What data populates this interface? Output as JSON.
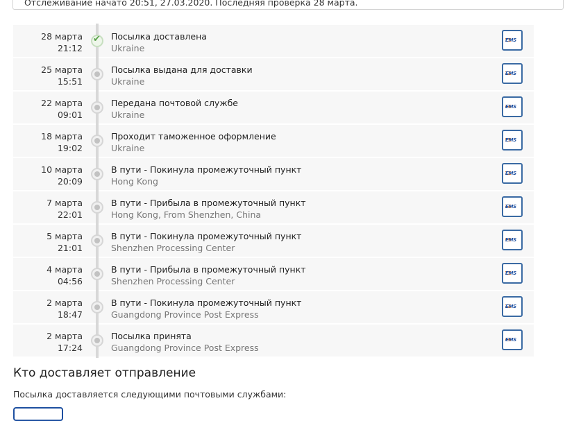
{
  "notice": {
    "text": "Отслеживание начато 20:51, 27.03.2020. Последняя проверка 28 марта."
  },
  "events": [
    {
      "date": "28 марта",
      "time": "21:12",
      "status": "Посылка доставлена",
      "location": "Ukraine",
      "done": true
    },
    {
      "date": "25 марта",
      "time": "15:51",
      "status": "Посылка выдана для доставки",
      "location": "Ukraine",
      "done": false
    },
    {
      "date": "22 марта",
      "time": "09:01",
      "status": "Передана почтовой службе",
      "location": "Ukraine",
      "done": false
    },
    {
      "date": "18 марта",
      "time": "19:02",
      "status": "Проходит таможенное оформление",
      "location": "Ukraine",
      "done": false
    },
    {
      "date": "10 марта",
      "time": "20:09",
      "status": "В пути - Покинула промежуточный пункт",
      "location": "Hong Kong",
      "done": false
    },
    {
      "date": "7 марта",
      "time": "22:01",
      "status": "В пути - Прибыла в промежуточный пункт",
      "location": "Hong Kong, From Shenzhen, China",
      "done": false
    },
    {
      "date": "5 марта",
      "time": "21:01",
      "status": "В пути - Покинула промежуточный пункт",
      "location": "Shenzhen Processing Center",
      "done": false
    },
    {
      "date": "4 марта",
      "time": "04:56",
      "status": "В пути - Прибыла в промежуточный пункт",
      "location": "Shenzhen Processing Center",
      "done": false
    },
    {
      "date": "2 марта",
      "time": "18:47",
      "status": "В пути - Покинула промежуточный пункт",
      "location": "Guangdong Province Post Express",
      "done": false
    },
    {
      "date": "2 марта",
      "time": "17:24",
      "status": "Посылка принята",
      "location": "Guangdong Province Post Express",
      "done": false
    }
  ],
  "carrier_icon": "ems-logo-icon",
  "carrier_label": "EMS",
  "section": {
    "title": "Кто доставляет отправление",
    "text": "Посылка доставляется следующими почтовыми службами:"
  },
  "colors": {
    "carrier_border": "#3a6aa3",
    "done_check": "#5aa24a",
    "row_bg": "#f7f7f7"
  }
}
